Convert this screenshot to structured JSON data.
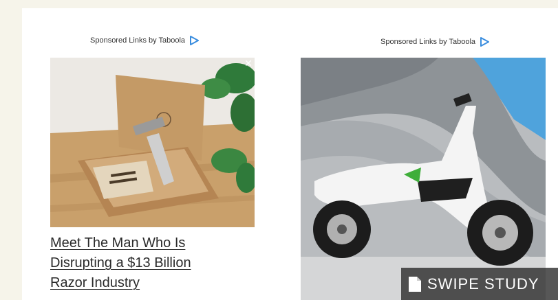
{
  "ads": [
    {
      "sponsored_label": "Sponsored Links by Taboola",
      "headline_lines": [
        "Meet The Man Who Is",
        "Disrupting a $13 Billion",
        "Razor Industry"
      ]
    },
    {
      "sponsored_label": "Sponsored Links by Taboola"
    }
  ],
  "watermark": {
    "label": "SWIPE STUDY",
    "icon": "document-icon"
  },
  "colors": {
    "page_bg": "#f6f4ea",
    "taboola_blue": "#3a8dde",
    "scooter_accent": "#3fae3a"
  },
  "icons": {
    "taboola": "taboola-play-icon",
    "close": "close-icon"
  }
}
